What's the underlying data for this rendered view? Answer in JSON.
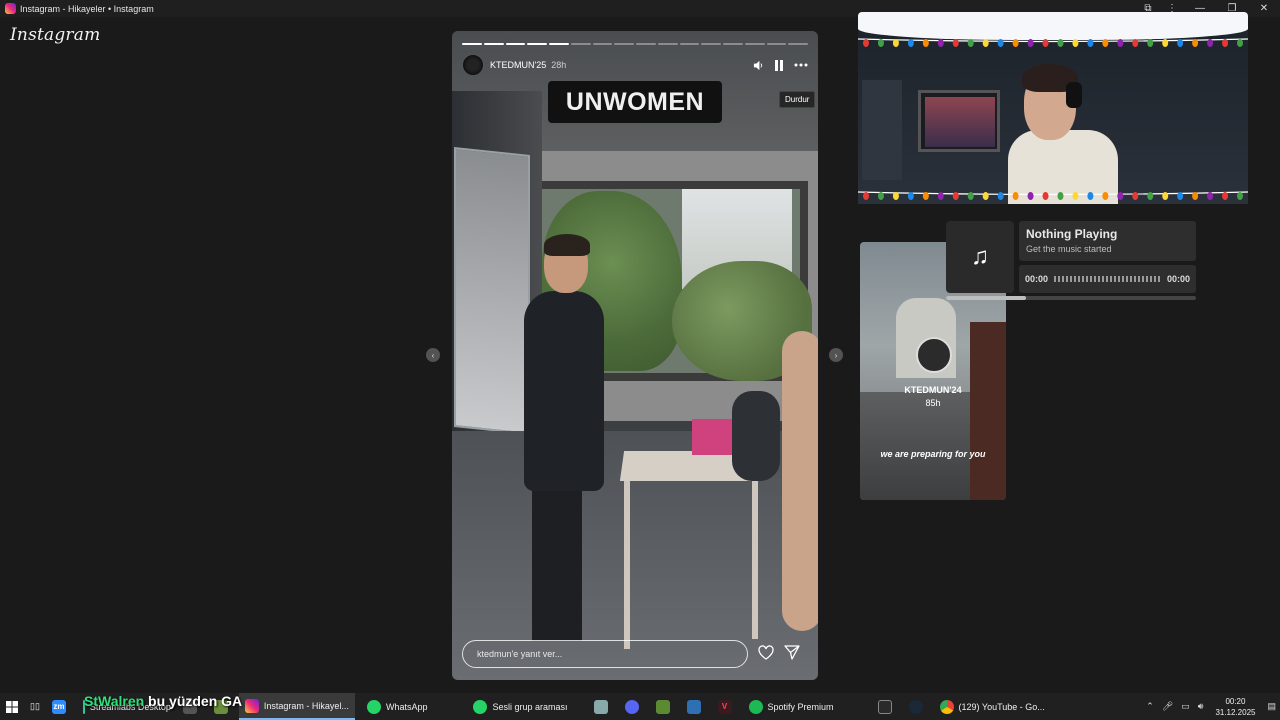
{
  "window": {
    "title": "Instagram - Hikayeler • Instagram"
  },
  "page": {
    "logo": "Instagram"
  },
  "story": {
    "username": "KTEDMUN'25",
    "time": "28h",
    "sticker": "UNWOMEN",
    "tooltip": "Durdur",
    "reply_placeholder": "ktedmun'e yanıt ver...",
    "progress_segments": 16,
    "progress_done": 5
  },
  "next_story": {
    "username": "KTEDMUN'24",
    "time": "85h",
    "caption": "we are preparing for you"
  },
  "music": {
    "title": "Nothing Playing",
    "subtitle": "Get the music started",
    "time_start": "00:00",
    "time_end": "00:00"
  },
  "taskbar": {
    "overlay": {
      "name": "StWalren",
      "message": " bu yüzden GA"
    },
    "items": [
      {
        "label": "Streamlabs Desktop"
      },
      {
        "label": "Instagram - Hikayel..."
      },
      {
        "label": "WhatsApp"
      },
      {
        "label": "Sesli grup araması"
      },
      {
        "label": "Spotify Premium"
      },
      {
        "label": "(129) YouTube - Go..."
      }
    ],
    "clock": {
      "time": "00:20",
      "date": "31.12.2025"
    }
  }
}
